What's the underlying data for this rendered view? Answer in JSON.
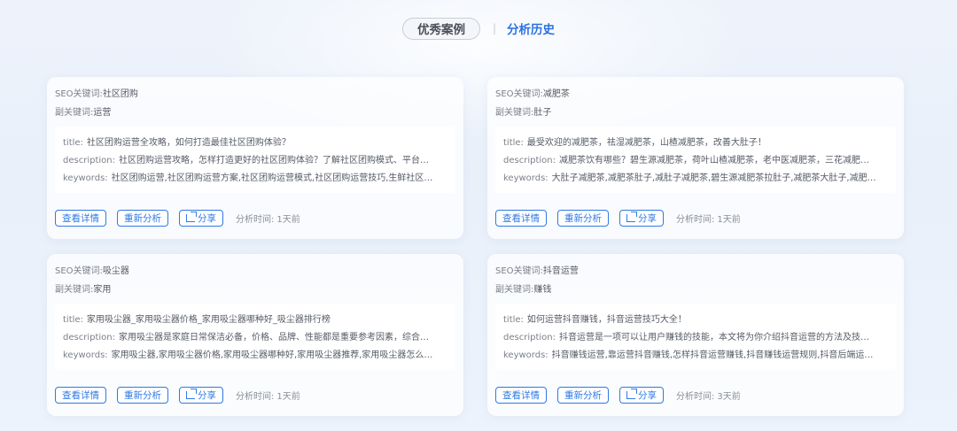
{
  "tabs": {
    "cases_label": "优秀案例",
    "separator": "|",
    "history_label": "分析历史"
  },
  "labels": {
    "seo_keyword": "SEO关键词:",
    "sub_keyword": "副关键词:",
    "title": "title:",
    "description": "description:",
    "keywords": "keywords:",
    "view_details": "查看详情",
    "reanalyze": "重新分析",
    "share": "分享",
    "analysis_time": "分析时间:"
  },
  "cards": [
    {
      "seo_keyword": "社区团购",
      "sub_keyword": "运营",
      "title": "社区团购运营全攻略，如何打造最佳社区团购体验？",
      "description": "社区团购运营攻略，怎样打造更好的社区团购体验？了解社区团购模式、平台…",
      "keywords": "社区团购运营,社区团购运营方案,社区团购运营模式,社区团购运营技巧,生鲜社区…",
      "time": "1天前"
    },
    {
      "seo_keyword": "减肥茶",
      "sub_keyword": "肚子",
      "title": "最受欢迎的减肥茶，祛湿减肥茶，山楂减肥茶，改善大肚子！",
      "description": "减肥茶饮有哪些？碧生源减肥茶，荷叶山楂减肥茶，老中医减肥茶，三花减肥…",
      "keywords": "大肚子减肥茶,减肥茶肚子,减肚子减肥茶,碧生源减肥茶拉肚子,减肥茶大肚子,减肥…",
      "time": "1天前"
    },
    {
      "seo_keyword": "吸尘器",
      "sub_keyword": "家用",
      "title": "家用吸尘器_家用吸尘器价格_家用吸尘器哪种好_吸尘器排行榜",
      "description": "家用吸尘器是家庭日常保洁必备，价格、品牌、性能都是重要参考因素，综合…",
      "keywords": "家用吸尘器,家用吸尘器价格,家用吸尘器哪种好,家用吸尘器推荐,家用吸尘器怎么…",
      "time": "1天前"
    },
    {
      "seo_keyword": "抖音运营",
      "sub_keyword": "赚钱",
      "title": "如何运营抖音赚钱，抖音运营技巧大全！",
      "description": "抖音运营是一项可以让用户赚钱的技能，本文将为你介绍抖音运营的方法及技…",
      "keywords": "抖音赚钱运营,靠运营抖音赚钱,怎样抖音运营赚钱,抖音赚钱运营规则,抖音后端运…",
      "time": "3天前"
    }
  ]
}
